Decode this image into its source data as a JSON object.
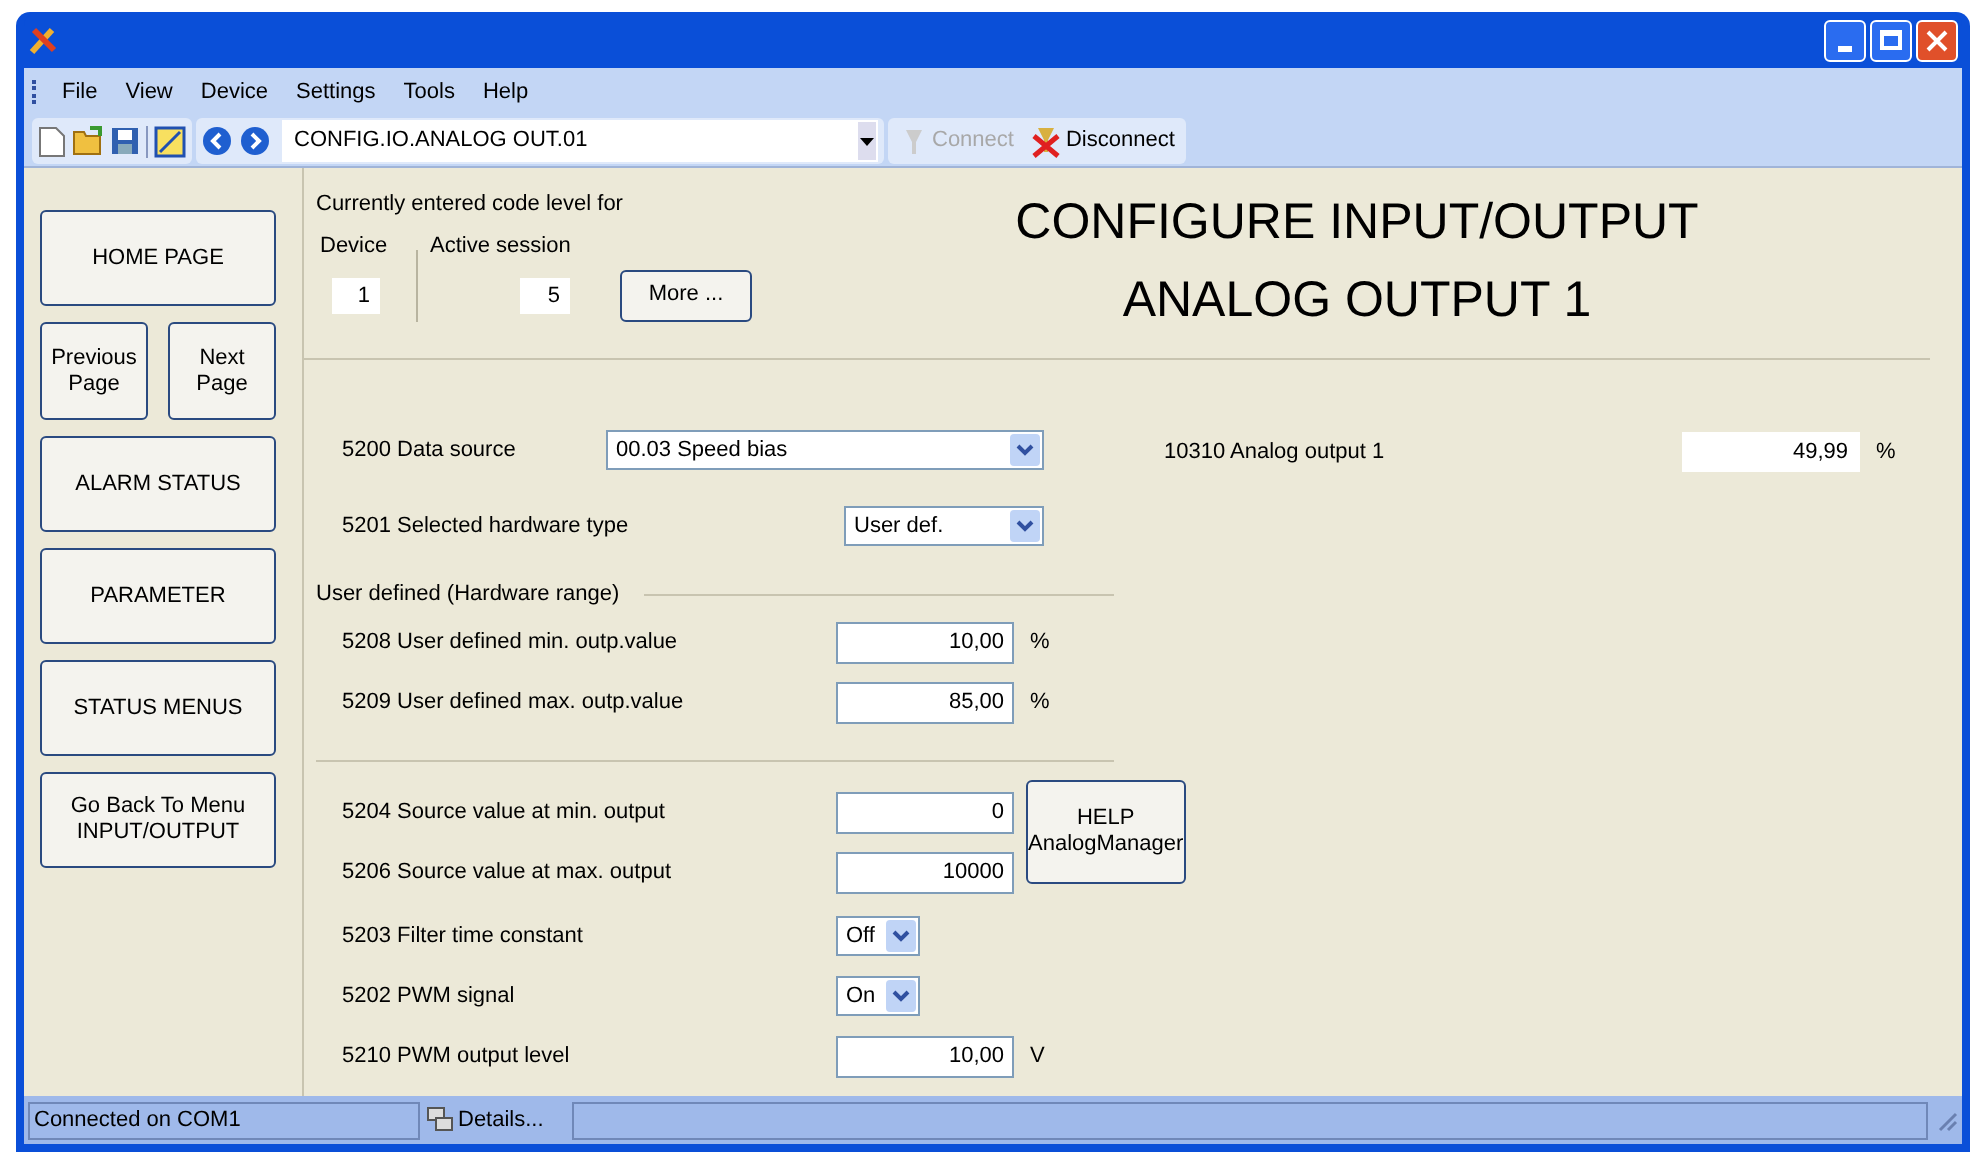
{
  "menu": [
    "File",
    "View",
    "Device",
    "Settings",
    "Tools",
    "Help"
  ],
  "toolbar": {
    "address": "CONFIG.IO.ANALOG OUT.01",
    "buttons": [
      {
        "label": "Connect",
        "kind": "connect",
        "disabled": true
      },
      {
        "label": "Disconnect",
        "kind": "disconnect",
        "disabled": false
      }
    ]
  },
  "nav_buttons": [
    {
      "label": "HOME PAGE",
      "kind": "wide"
    },
    {
      "label": "Previous\nPage",
      "kind": "half"
    },
    {
      "label": "Next\nPage",
      "kind": "half"
    },
    {
      "label": "ALARM STATUS",
      "kind": "wide"
    },
    {
      "label": "PARAMETER",
      "kind": "wide"
    },
    {
      "label": "STATUS MENUS",
      "kind": "wide"
    },
    {
      "label": "Go Back To Menu\nINPUT/OUTPUT",
      "kind": "wide"
    }
  ],
  "code_level": {
    "heading": "Currently entered code level for",
    "device_label": "Device",
    "device_value": "1",
    "session_label": "Active session",
    "session_value": "5",
    "more_button": "More ..."
  },
  "title": [
    "CONFIGURE INPUT/OUTPUT",
    "ANALOG OUTPUT 1"
  ],
  "sections": [
    {
      "rows": [
        {
          "label": "5200 Data source",
          "kind": "wide-select",
          "value": "00.03 Speed bias"
        },
        {
          "label": "5201 Selected hardware type",
          "kind": "select",
          "value": "User def."
        }
      ]
    },
    {
      "title": "User defined (Hardware range)",
      "rows": [
        {
          "label": "5208 User defined min. outp.value",
          "kind": "number",
          "value": "10,00",
          "unit": "%"
        },
        {
          "label": "5209 User defined max. outp.value",
          "kind": "number",
          "value": "85,00",
          "unit": "%"
        }
      ]
    },
    {
      "help_button": "HELP\nAnalogManager",
      "rows": [
        {
          "label": "5204 Source value at min. output",
          "kind": "number",
          "value": "0"
        },
        {
          "label": "5206 Source value at max. output",
          "kind": "number",
          "value": "10000"
        }
      ]
    },
    {
      "rows": [
        {
          "label": "5203 Filter time constant",
          "kind": "small-select",
          "value": "Off"
        },
        {
          "label": "5202 PWM signal",
          "kind": "small-select",
          "value": "On"
        },
        {
          "label": "5210 PWM output level",
          "kind": "number",
          "value": "10,00",
          "unit": "V"
        }
      ]
    }
  ],
  "readout": {
    "label": "10310 Analog output 1",
    "value": "49,99",
    "unit": "%"
  },
  "status_bar": {
    "text": "Connected on COM1",
    "details": "Details..."
  }
}
